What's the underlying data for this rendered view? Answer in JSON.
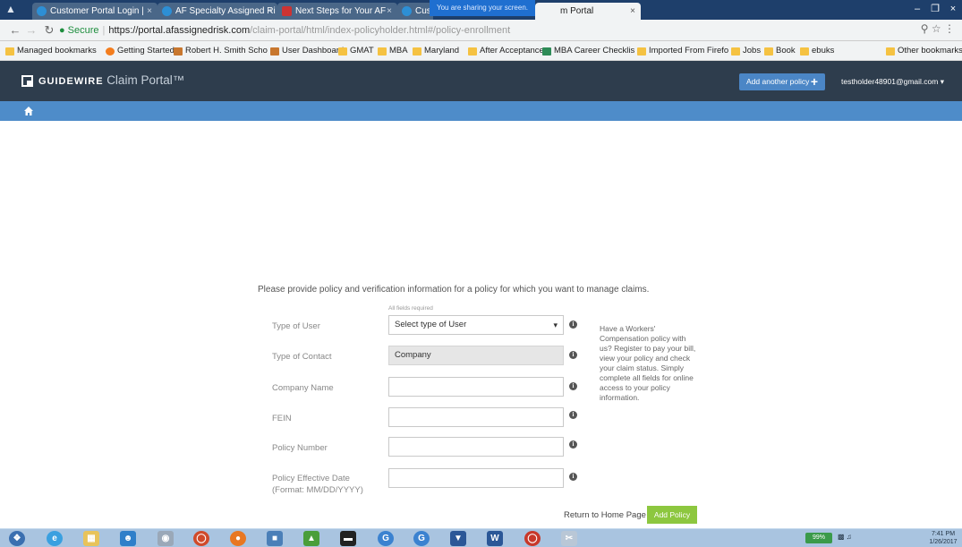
{
  "browser": {
    "tabs": [
      {
        "title": "Customer Portal Login |",
        "icon": "globe-icon"
      },
      {
        "title": "AF Specialty Assigned Ri",
        "icon": "globe-icon"
      },
      {
        "title": "Next Steps for Your AF",
        "icon": "mail-icon"
      },
      {
        "title": "Cus",
        "icon": "globe-icon"
      },
      {
        "title": "m Portal",
        "icon": "globe-icon"
      }
    ],
    "share_banner": "You are sharing your screen.",
    "url": {
      "secure_label": "Secure",
      "host": "https://portal.afassignedrisk.com",
      "path": "/claim-portal/html/index-policyholder.html#/policy-enrollment"
    },
    "bookmarks": [
      "Managed bookmarks",
      "Getting Started",
      "Robert H. Smith Scho",
      "User Dashboard",
      "GMAT",
      "MBA",
      "Maryland",
      "After Acceptance",
      "MBA Career Checklis",
      "Imported From Firefo",
      "Jobs",
      "Book",
      "ebuks",
      "Other bookmarks"
    ]
  },
  "header": {
    "brand_bold": "GUIDEWIRE",
    "brand_light": "Claim Portal™",
    "add_policy_label": "Add another policy",
    "user_email": "testholder48901@gmail.com"
  },
  "form": {
    "intro": "Please provide policy and verification information for a policy for which you want to manage claims.",
    "required_note": "All fields required",
    "type_of_user": {
      "label": "Type of User",
      "value": "Select type of User"
    },
    "type_of_contact": {
      "label": "Type of Contact",
      "value": "Company"
    },
    "company_name": {
      "label": "Company Name",
      "value": ""
    },
    "fein": {
      "label": "FEIN",
      "value": ""
    },
    "policy_number": {
      "label": "Policy Number",
      "value": ""
    },
    "effective_date": {
      "label_line1": "Policy Effective Date",
      "label_line2": "(Format: MM/DD/YYYY)",
      "value": ""
    },
    "help_text": "Have a Workers' Compensation policy with us? Register to pay your bill, view your policy and check your claim status. Simply complete all fields for online access to your policy information.",
    "return_label": "Return to Home Page",
    "submit_label": "Add Policy"
  },
  "taskbar": {
    "battery": "99%",
    "time": "7:41 PM",
    "date": "1/26/2017"
  },
  "colors": {
    "header_bg": "#2e3d4d",
    "nav_strip": "#4e8cc9",
    "add_btn": "#8dc73f",
    "primary_btn": "#4b86c6"
  }
}
